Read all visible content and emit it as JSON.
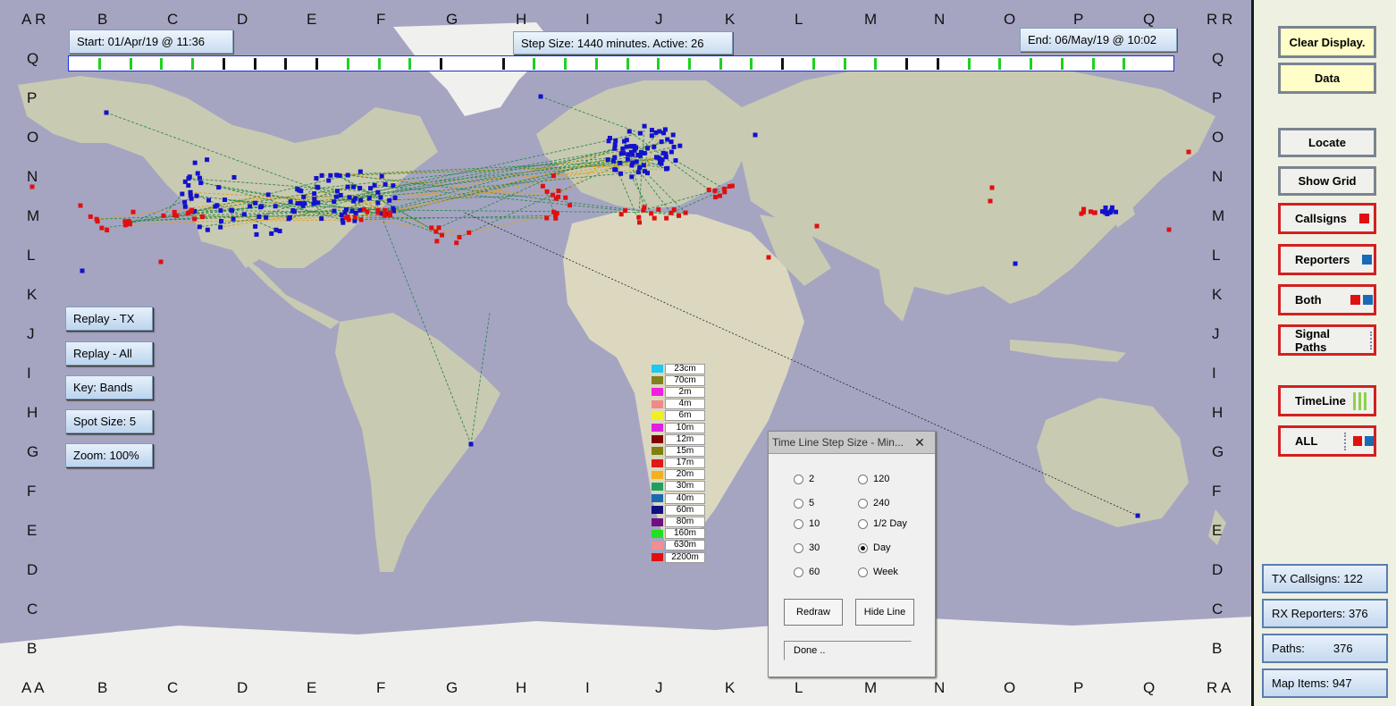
{
  "map": {
    "grid_top": [
      "B",
      "C",
      "D",
      "E",
      "F",
      "G",
      "H",
      "I",
      "J",
      "K",
      "L",
      "M",
      "N",
      "O",
      "P",
      "Q"
    ],
    "grid_left": [
      "Q",
      "P",
      "O",
      "N",
      "M",
      "L",
      "K",
      "J",
      "I",
      "H",
      "G",
      "F",
      "E",
      "D",
      "C",
      "B"
    ],
    "corner_tl": "A R",
    "corner_tr": "R R",
    "corner_bl": "A A",
    "corner_br": "R A",
    "colors": {
      "ocean": "#a5a5c2",
      "land": "#c7c8b0",
      "ice": "#f2f2f0",
      "callsign": "#e01010",
      "reporter": "#1212cc"
    }
  },
  "topbar": {
    "start": "Start: 01/Apr/19 @ 11:36",
    "step": "Step Size: 1440 minutes. Active: 26",
    "end": "End:  06/May/19 @ 10:02"
  },
  "timeline": {
    "ticks": [
      "green",
      "green",
      "green",
      "green",
      "black",
      "black",
      "black",
      "black",
      "green",
      "green",
      "green",
      "black",
      "white",
      "black",
      "green",
      "green",
      "green",
      "green",
      "green",
      "green",
      "green",
      "green",
      "black",
      "green",
      "green",
      "green",
      "black",
      "black",
      "green",
      "green",
      "green",
      "green",
      "green",
      "green",
      "white"
    ]
  },
  "left_buttons": {
    "replay_tx": "Replay - TX",
    "replay_all": "Replay - All",
    "key": "Key:  Bands",
    "spot_size": "Spot Size:   5",
    "zoom": "Zoom: 100%"
  },
  "legend": [
    {
      "label": "23cm",
      "color": "#1ec8f0"
    },
    {
      "label": "70cm",
      "color": "#808020"
    },
    {
      "label": "2m",
      "color": "#f020e0"
    },
    {
      "label": "4m",
      "color": "#f08a8a"
    },
    {
      "label": "6m",
      "color": "#f0f020"
    },
    {
      "label": "10m",
      "color": "#e020e0"
    },
    {
      "label": "12m",
      "color": "#800000"
    },
    {
      "label": "15m",
      "color": "#808010"
    },
    {
      "label": "17m",
      "color": "#e01818"
    },
    {
      "label": "20m",
      "color": "#f0b020"
    },
    {
      "label": "30m",
      "color": "#20a060"
    },
    {
      "label": "40m",
      "color": "#1a6ab0"
    },
    {
      "label": "60m",
      "color": "#101080"
    },
    {
      "label": "80m",
      "color": "#701080"
    },
    {
      "label": "160m",
      "color": "#20e020"
    },
    {
      "label": "630m",
      "color": "#f09090"
    },
    {
      "label": "2200m",
      "color": "#e01010"
    }
  ],
  "panel": {
    "clear": "Clear Display.",
    "data": "Data",
    "locate": "Locate",
    "show_grid": "Show Grid",
    "callsigns": "Callsigns",
    "reporters": "Reporters",
    "both": "Both",
    "signal_paths": "Signal Paths",
    "timeline": "TimeLine",
    "all": "ALL",
    "tx_callsigns": "TX Callsigns: 122",
    "rx_reporters": "RX Reporters: 376",
    "paths_label": "Paths:",
    "paths_value": "376",
    "map_items": "Map Items: 947"
  },
  "dialog": {
    "title": "Time Line Step Size - Min...",
    "close": "✕",
    "options": [
      "2",
      "5",
      "10",
      "30",
      "60",
      "120",
      "240",
      "1/2 Day",
      "Day",
      "Week"
    ],
    "selected": "Day",
    "redraw": "Redraw",
    "hide_line": "Hide Line",
    "status": "Done .."
  }
}
